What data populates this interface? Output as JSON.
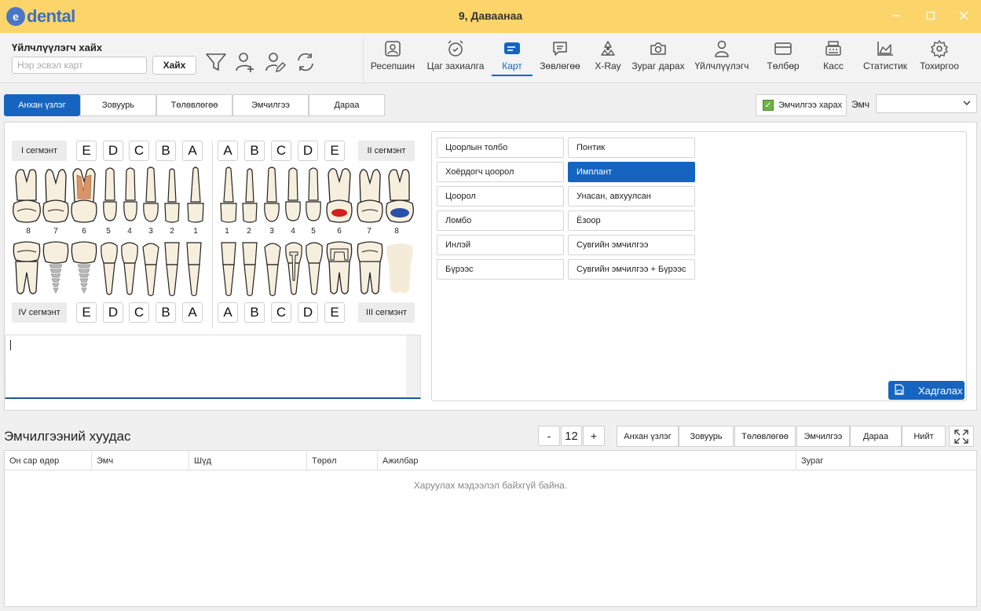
{
  "app": {
    "logo_text": "dental",
    "window_title": "9, Даваанаа"
  },
  "toolbar": {
    "search_title": "Үйлчлүүлэгч хайх",
    "search_placeholder": "Нэр эсвэл карт",
    "search_button": "Хайх",
    "icons": [
      "filter-icon",
      "add-user-icon",
      "edit-user-icon",
      "refresh-icon"
    ]
  },
  "nav": [
    {
      "label": "Ресепшин",
      "icon": "reception-icon"
    },
    {
      "label": "Цаг захиалга",
      "icon": "alarm-clock-icon"
    },
    {
      "label": "Карт",
      "icon": "card-icon",
      "active": true
    },
    {
      "label": "Зөвлөгөө",
      "icon": "chat-icon"
    },
    {
      "label": "X-Ray",
      "icon": "radiation-icon"
    },
    {
      "label": "Зураг дарах",
      "icon": "camera-icon"
    },
    {
      "label": "Үйлчлүүлэгч",
      "icon": "person-icon"
    },
    {
      "label": "Төлбөр",
      "icon": "credit-card-icon"
    },
    {
      "label": "Касс",
      "icon": "cash-register-icon"
    },
    {
      "label": "Статистик",
      "icon": "chart-icon"
    },
    {
      "label": "Тохиргоо",
      "icon": "gear-icon"
    }
  ],
  "tabs": [
    {
      "label": "Анхан үзлэг",
      "active": true
    },
    {
      "label": "Зовуурь"
    },
    {
      "label": "Төлөвлөгөө"
    },
    {
      "label": "Эмчилгээ"
    },
    {
      "label": "Дараа"
    }
  ],
  "view_treatment_button": "Эмчилгээ харах",
  "doctor_label": "Эмч",
  "doctor_value": "",
  "segments": {
    "I": "I сегмэнт",
    "II": "II сегмэнт",
    "III": "III сегмэнт",
    "IV": "IV сегмэнт"
  },
  "letters_upper_left": [
    "E",
    "D",
    "C",
    "B",
    "A"
  ],
  "letters_upper_right": [
    "A",
    "B",
    "C",
    "D",
    "E"
  ],
  "letters_lower_left": [
    "E",
    "D",
    "C",
    "B",
    "A"
  ],
  "letters_lower_right": [
    "A",
    "B",
    "C",
    "D",
    "E"
  ],
  "tooth_numbers_left": [
    "8",
    "7",
    "6",
    "5",
    "4",
    "3",
    "2",
    "1"
  ],
  "tooth_numbers_right": [
    "1",
    "2",
    "3",
    "4",
    "5",
    "6",
    "7",
    "8"
  ],
  "note_text": "",
  "procedures_left": [
    "Цоорлын толбо",
    "Хоёрдогч цоорол",
    "Цоорол",
    "Ломбо",
    "Инлэй",
    "Бүрээс"
  ],
  "procedures_right": [
    "Понтик",
    "Имплант",
    "Унасан, авхуулсан",
    "Ёзоор",
    "Сувгийн эмчилгээ",
    "Сувгийн эмчилгээ + Бүрээс"
  ],
  "procedure_active": "Имплант",
  "save_button": "Хадгалах",
  "sheet": {
    "title": "Эмчилгээний хуудас",
    "minus": "-",
    "plus": "+",
    "page_value": "12",
    "filters": [
      "Анхан үзлэг",
      "Зовуурь",
      "Төлөвлөгөө",
      "Эмчилгээ",
      "Дараа",
      "Нийт"
    ],
    "columns": [
      "Он сар өдөр",
      "Эмч",
      "Шүд",
      "Төрөл",
      "Ажилбар",
      "Зураг"
    ],
    "empty_message": "Харуулах мэдээлэл байхгүй байна."
  },
  "colors": {
    "titlebar": "#fbd56a",
    "accent": "#1565c0",
    "tooth_fill": "#f7efdd",
    "root_canal": "#d9956a",
    "filling_red": "#d32020",
    "filling_blue": "#2a4fa8"
  }
}
